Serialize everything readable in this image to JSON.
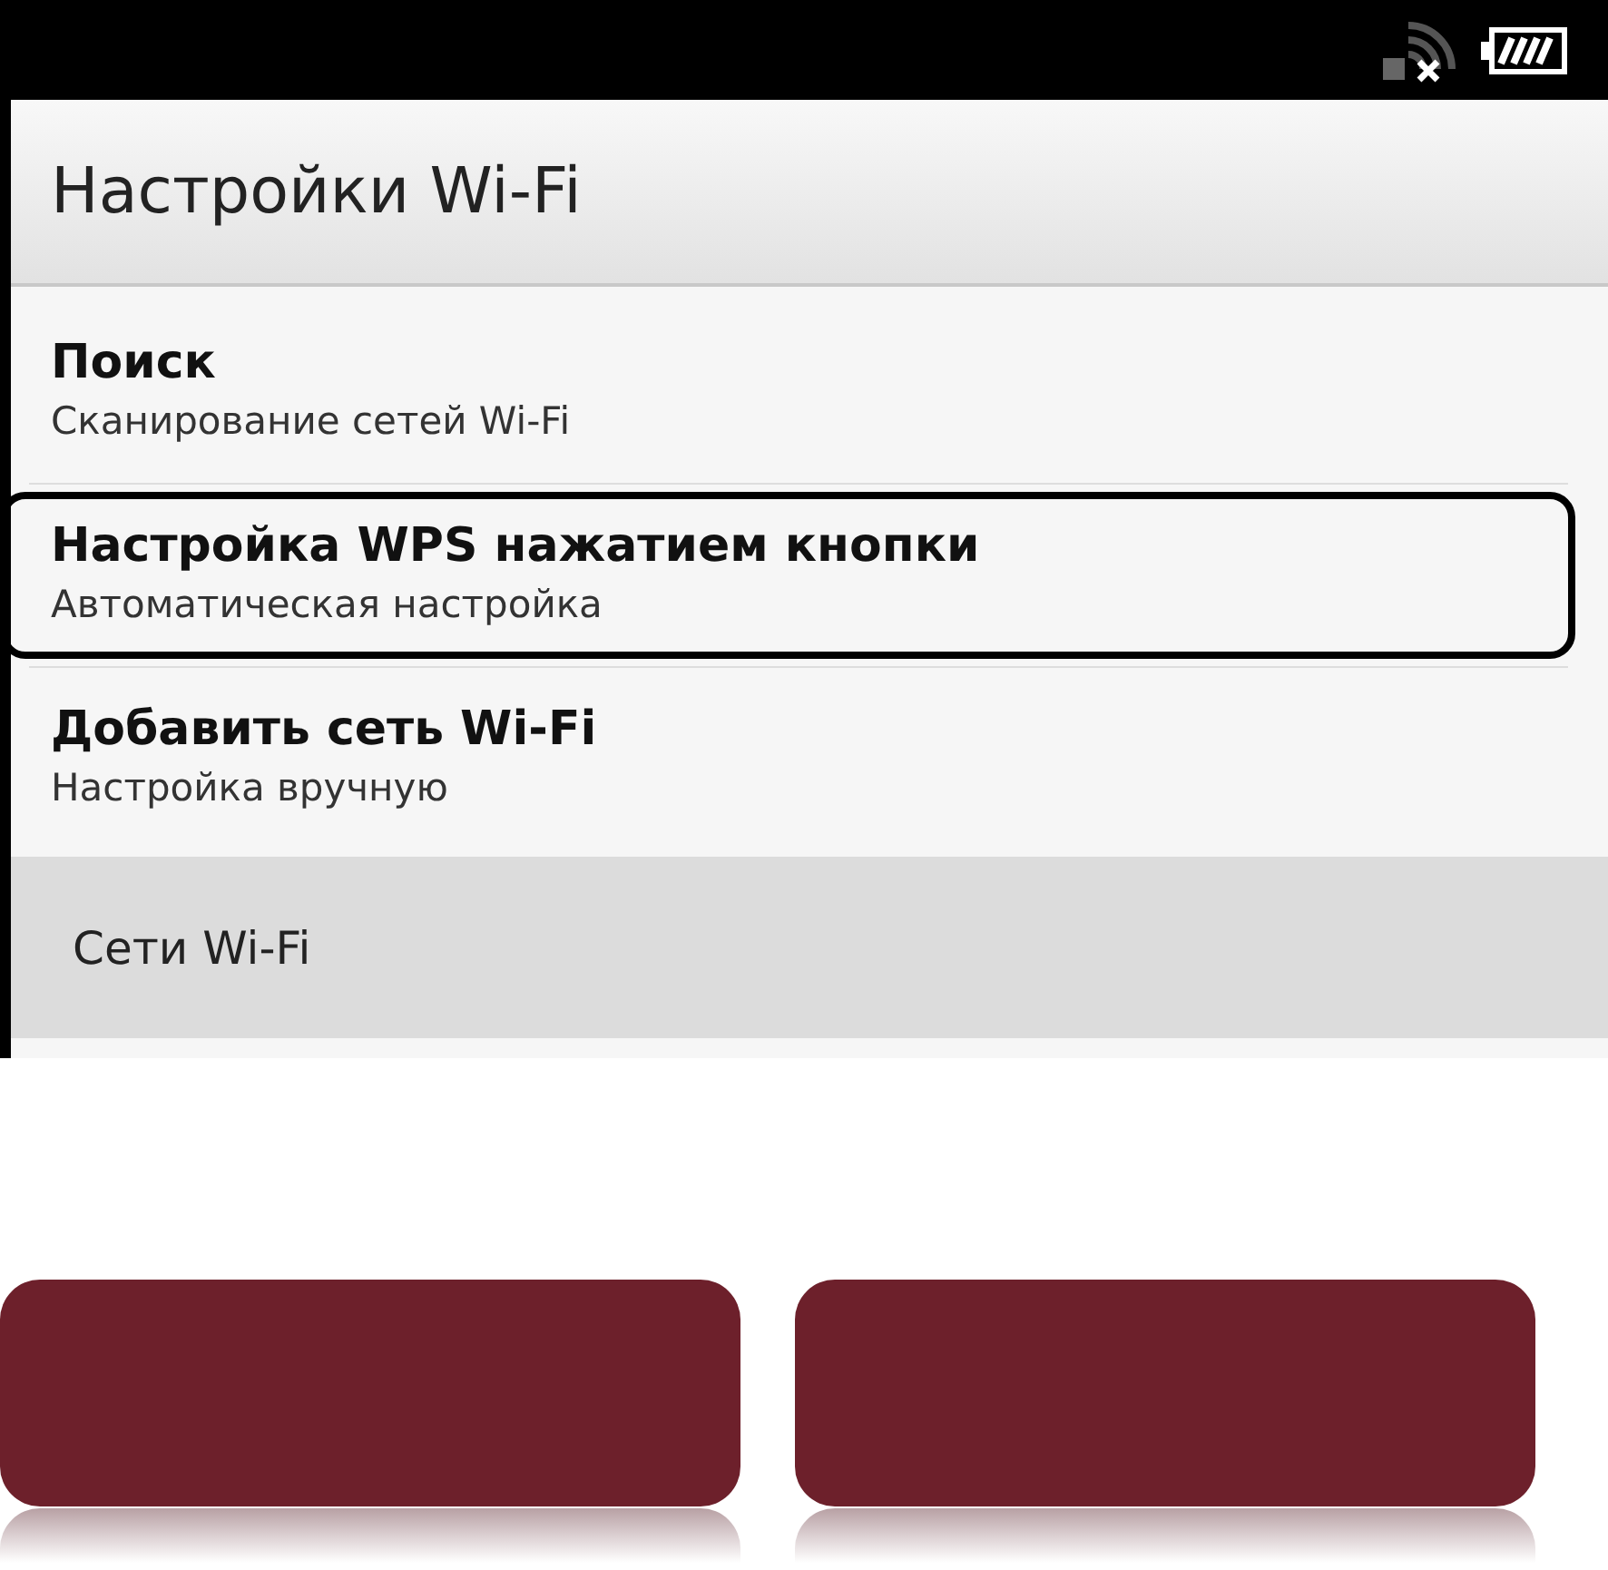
{
  "screen": {
    "title": "Настройки Wi-Fi",
    "items": [
      {
        "title": "Поиск",
        "subtitle": "Сканирование сетей Wi-Fi",
        "selected": false
      },
      {
        "title": "Настройка WPS нажатием кнопки",
        "subtitle": "Автоматическая настройка",
        "selected": true
      },
      {
        "title": "Добавить сеть Wi-Fi",
        "subtitle": "Настройка вручную",
        "selected": false
      }
    ],
    "section_header": "Сети Wi-Fi"
  }
}
